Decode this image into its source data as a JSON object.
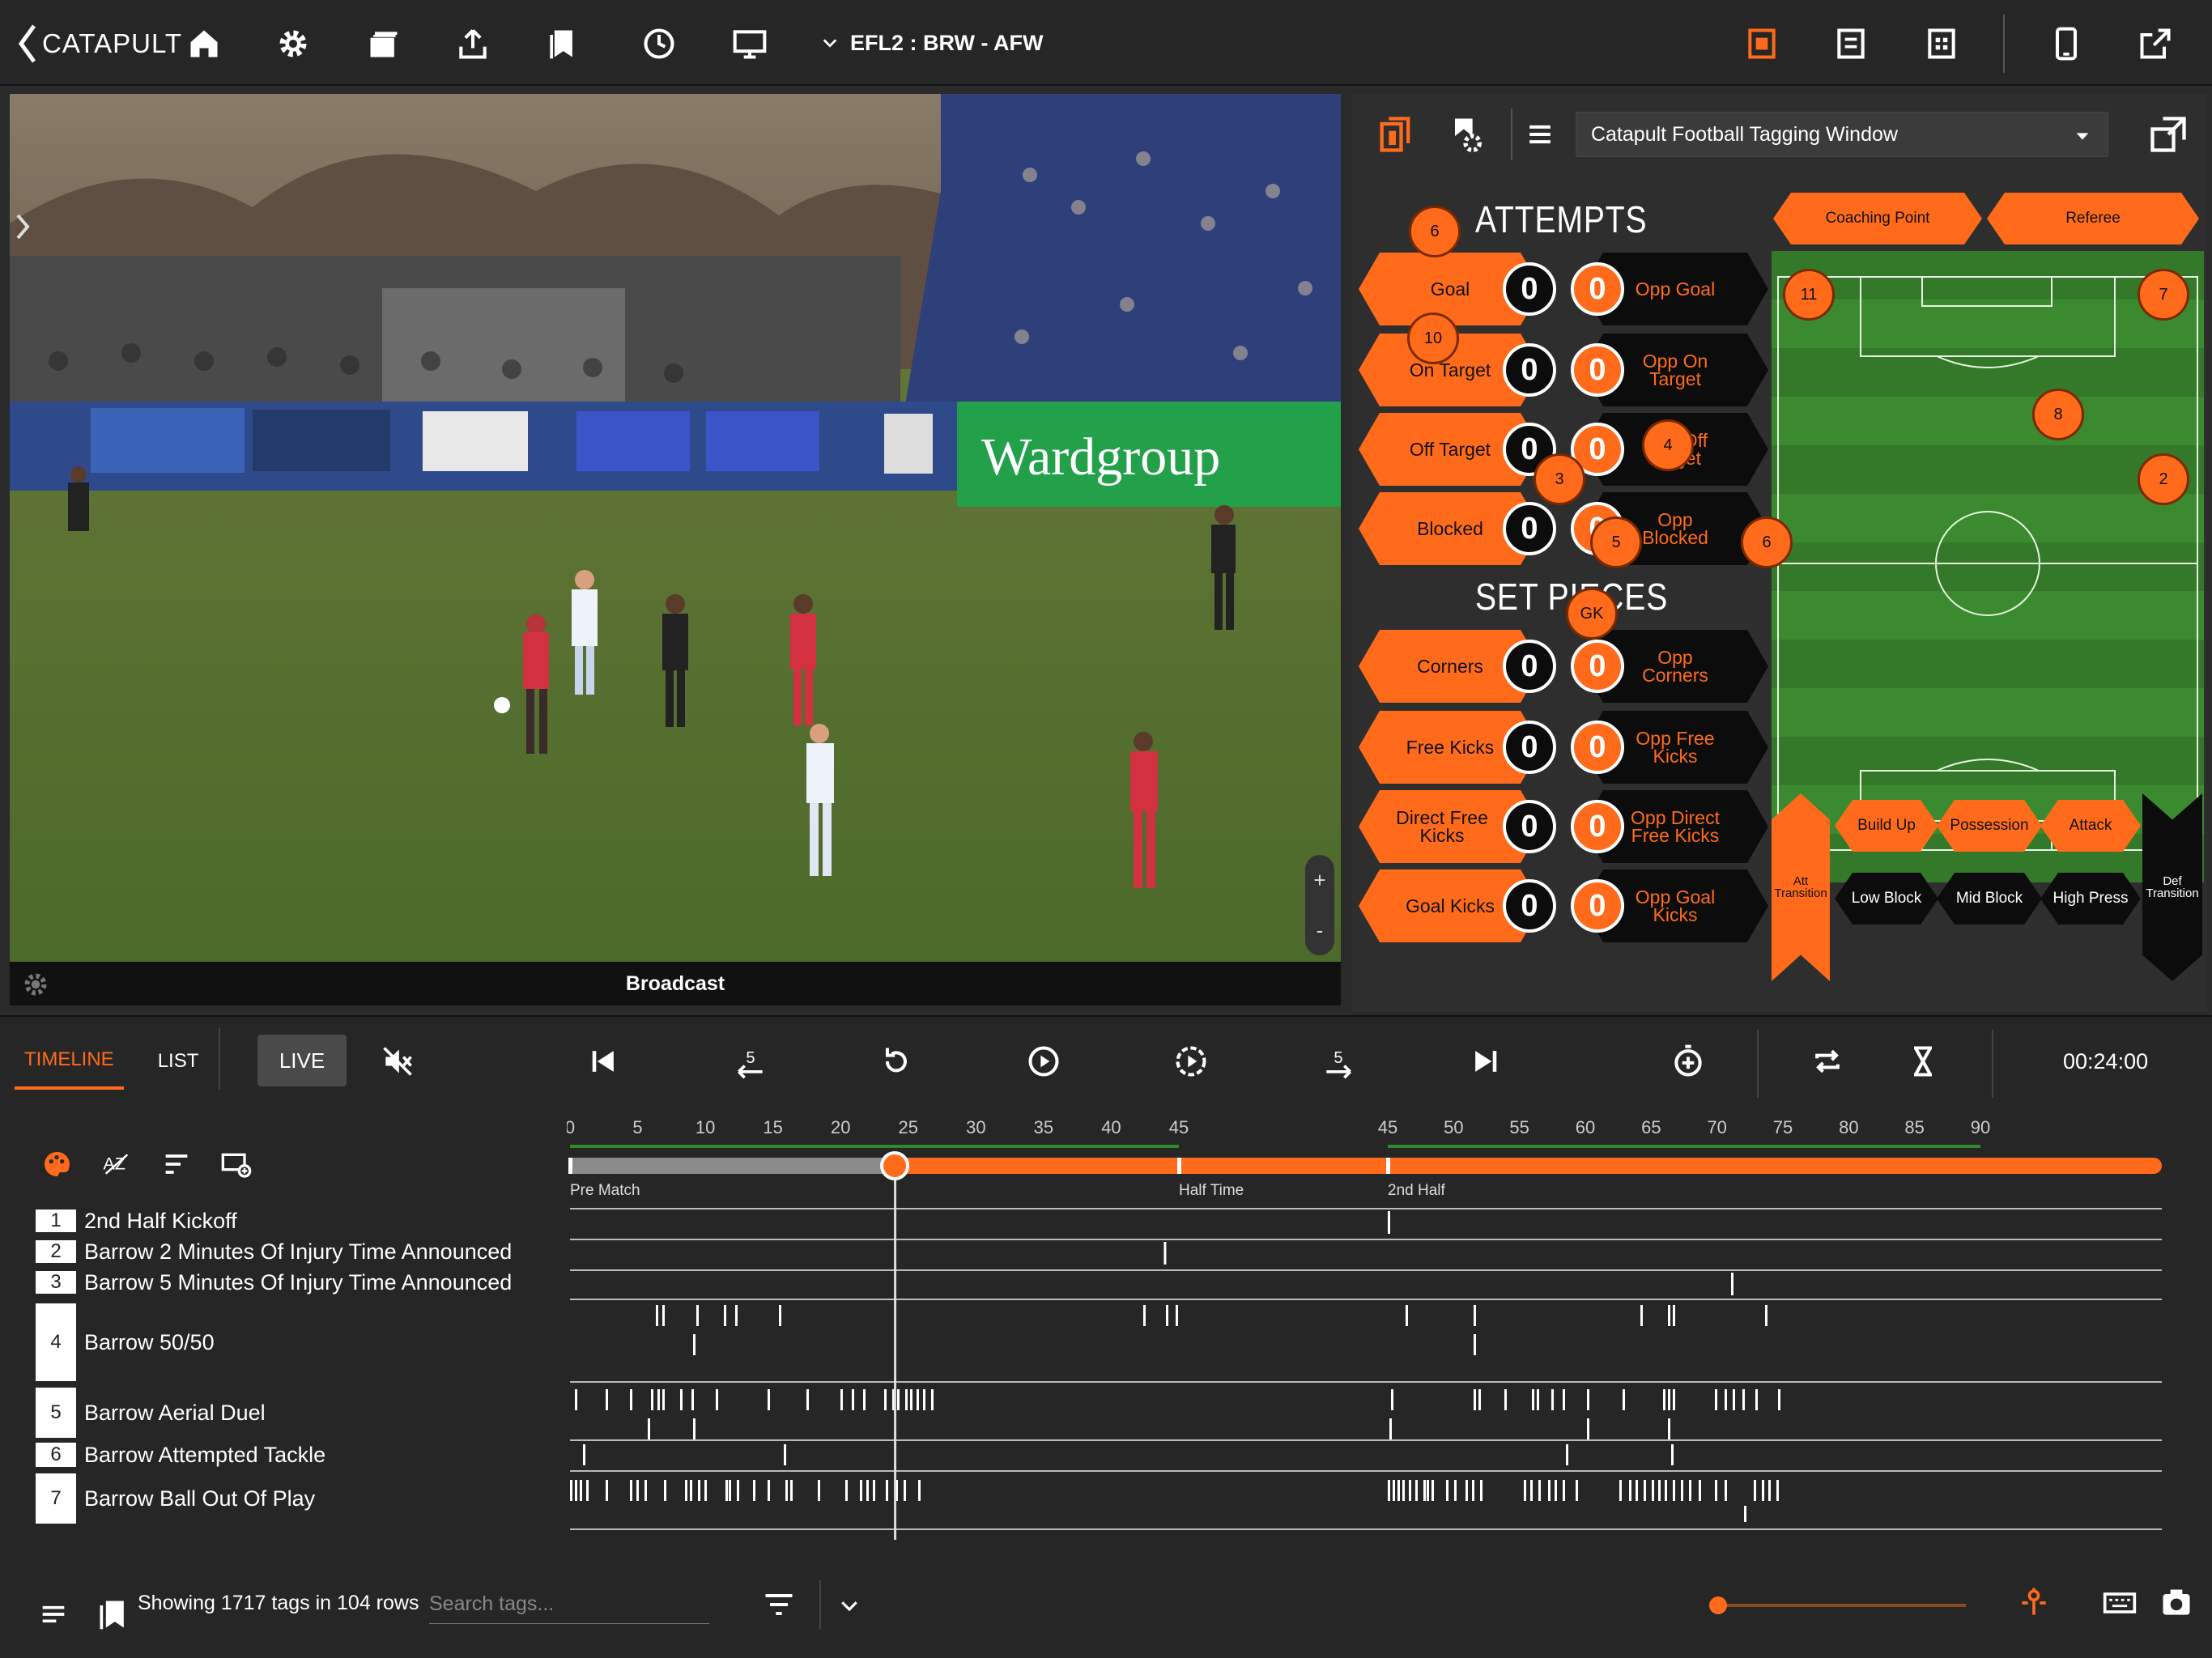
{
  "topbar": {
    "logo": "CATAPULT",
    "match": "EFL2 : BRW - AFW",
    "accent": "#ff6b1a"
  },
  "video": {
    "caption": "Broadcast",
    "zoom_in": "+",
    "zoom_out": "-"
  },
  "tagpanel": {
    "window_select": "Catapult Football Tagging Window",
    "attempts_title": "ATTEMPTS",
    "setpieces_title": "SET PIECES",
    "coaching_point": "Coaching Point",
    "referee": "Referee",
    "attempts": [
      {
        "label": "Goal",
        "count": "0",
        "opp_label": "Opp Goal",
        "opp_count": "0"
      },
      {
        "label": "On Target",
        "count": "0",
        "opp_label": "Opp On Target",
        "opp_count": "0"
      },
      {
        "label": "Off Target",
        "count": "0",
        "opp_label": "Opp Off Target",
        "opp_count": "0"
      },
      {
        "label": "Blocked",
        "count": "0",
        "opp_label": "Opp Blocked",
        "opp_count": "0"
      }
    ],
    "setpieces": [
      {
        "label": "Corners",
        "count": "0",
        "opp_label": "Opp Corners",
        "opp_count": "0"
      },
      {
        "label": "Free Kicks",
        "count": "0",
        "opp_label": "Opp Free Kicks",
        "opp_count": "0"
      },
      {
        "label": "Direct Free Kicks",
        "count": "0",
        "opp_label": "Opp Direct Free Kicks",
        "opp_count": "0"
      },
      {
        "label": "Goal Kicks",
        "count": "0",
        "opp_label": "Opp Goal Kicks",
        "opp_count": "0"
      }
    ],
    "phases": {
      "att_transition": "Att Transition",
      "def_transition": "Def Transition",
      "build_up": "Build Up",
      "possession": "Possession",
      "attack": "Attack",
      "low_block": "Low Block",
      "mid_block": "Mid Block",
      "high_press": "High Press"
    },
    "players": [
      "6",
      "11",
      "7",
      "10",
      "8",
      "4",
      "3",
      "2",
      "5",
      "6",
      "GK"
    ]
  },
  "controls": {
    "tab_timeline": "TIMELINE",
    "tab_list": "LIST",
    "live": "LIVE",
    "skip_back": "5",
    "skip_fwd": "5",
    "time": "00:24:00"
  },
  "timeline": {
    "ticks_first": [
      "0",
      "5",
      "10",
      "15",
      "20",
      "25",
      "30",
      "35",
      "40",
      "45"
    ],
    "ticks_second": [
      "45",
      "50",
      "55",
      "60",
      "65",
      "70",
      "75",
      "80",
      "85",
      "90"
    ],
    "pre_match": "Pre Match",
    "half_time": "Half Time",
    "second_half": "2nd Half",
    "playhead_min": 24,
    "rows": [
      {
        "num": "1",
        "label": "2nd Half Kickoff"
      },
      {
        "num": "2",
        "label": "Barrow 2 Minutes Of Injury Time Announced"
      },
      {
        "num": "3",
        "label": "Barrow 5 Minutes Of Injury Time Announced"
      },
      {
        "num": "4",
        "label": "Barrow 50/50"
      },
      {
        "num": "5",
        "label": "Barrow Aerial Duel"
      },
      {
        "num": "6",
        "label": "Barrow Attempted Tackle"
      },
      {
        "num": "7",
        "label": "Barrow Ball Out Of Play"
      }
    ]
  },
  "footer": {
    "tag_count": "Showing 1717 tags in 104 rows",
    "search_placeholder": "Search tags..."
  }
}
